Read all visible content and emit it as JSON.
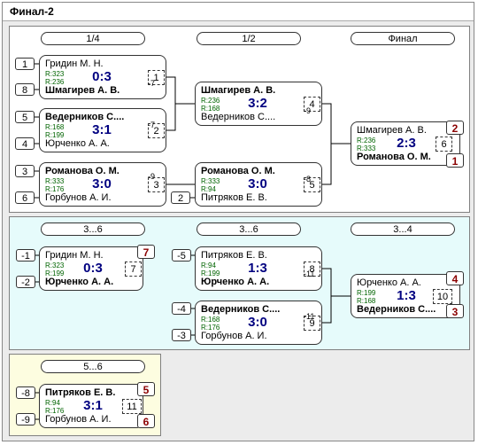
{
  "title": "Финал-2",
  "sections": {
    "main": {
      "headers": [
        "1/4",
        "1/2",
        "Финал"
      ],
      "seeds": [
        "1",
        "8",
        "5",
        "4",
        "3",
        "6",
        "2"
      ],
      "matches": [
        {
          "p1": "Гридин М. Н.",
          "p2": "Шмагирев А. В.",
          "r1": "R:323",
          "r2": "R:236",
          "score": "0:3",
          "no": "1",
          "winner": 2,
          "next": "-7"
        },
        {
          "p1": "Ведерников С....",
          "p2": "Юрченко А. А.",
          "r1": "R:168",
          "r2": "R:199",
          "score": "3:1",
          "no": "2",
          "winner": 1,
          "next": "-7"
        },
        {
          "p1": "Романова О. М.",
          "p2": "Горбунов А. И.",
          "r1": "R:333",
          "r2": "R:176",
          "score": "3:0",
          "no": "3",
          "winner": 1,
          "next": "-9"
        },
        {
          "p1": "Шмагирев А. В.",
          "p2": "Ведерников С....",
          "r1": "R:236",
          "r2": "R:168",
          "score": "3:2",
          "no": "4",
          "winner": 1,
          "next": "-9"
        },
        {
          "p1": "Романова О. М.",
          "p2": "Питряков Е. В.",
          "r1": "R:333",
          "r2": "R:94",
          "score": "3:0",
          "no": "5",
          "winner": 1,
          "next": "-8"
        },
        {
          "p1": "Шмагирев А. В.",
          "p2": "Романова О. М.",
          "r1": "R:236",
          "r2": "R:333",
          "score": "2:3",
          "no": "6",
          "winner": 2,
          "place1": "2",
          "place2": "1"
        }
      ]
    },
    "consolation": {
      "headers": [
        "3...6",
        "3...6",
        "3...4"
      ],
      "seeds": [
        "-1",
        "-2",
        "-5",
        "-4",
        "-3"
      ],
      "matches": [
        {
          "p1": "Гридин М. Н.",
          "p2": "Юрченко А. А.",
          "r1": "R:323",
          "r2": "R:199",
          "score": "0:3",
          "no": "7",
          "winner": 2,
          "place1": "7"
        },
        {
          "p1": "Питряков Е. В.",
          "p2": "Юрченко А. А.",
          "r1": "R:94",
          "r2": "R:199",
          "score": "1:3",
          "no": "8",
          "winner": 2,
          "next": "-11"
        },
        {
          "p1": "Ведерников С....",
          "p2": "Горбунов А. И.",
          "r1": "R:168",
          "r2": "R:176",
          "score": "3:0",
          "no": "9",
          "winner": 1,
          "next": "-11"
        },
        {
          "p1": "Юрченко А. А.",
          "p2": "Ведерников С....",
          "r1": "R:199",
          "r2": "R:168",
          "score": "1:3",
          "no": "10",
          "winner": 2,
          "place1": "4",
          "place2": "3"
        }
      ]
    },
    "fifth": {
      "headers": [
        "5...6"
      ],
      "seeds": [
        "-8",
        "-9"
      ],
      "matches": [
        {
          "p1": "Питряков Е. В.",
          "p2": "Горбунов А. И.",
          "r1": "R:94",
          "r2": "R:176",
          "score": "3:1",
          "no": "11",
          "winner": 1,
          "place1": "5",
          "place2": "6"
        }
      ]
    }
  }
}
